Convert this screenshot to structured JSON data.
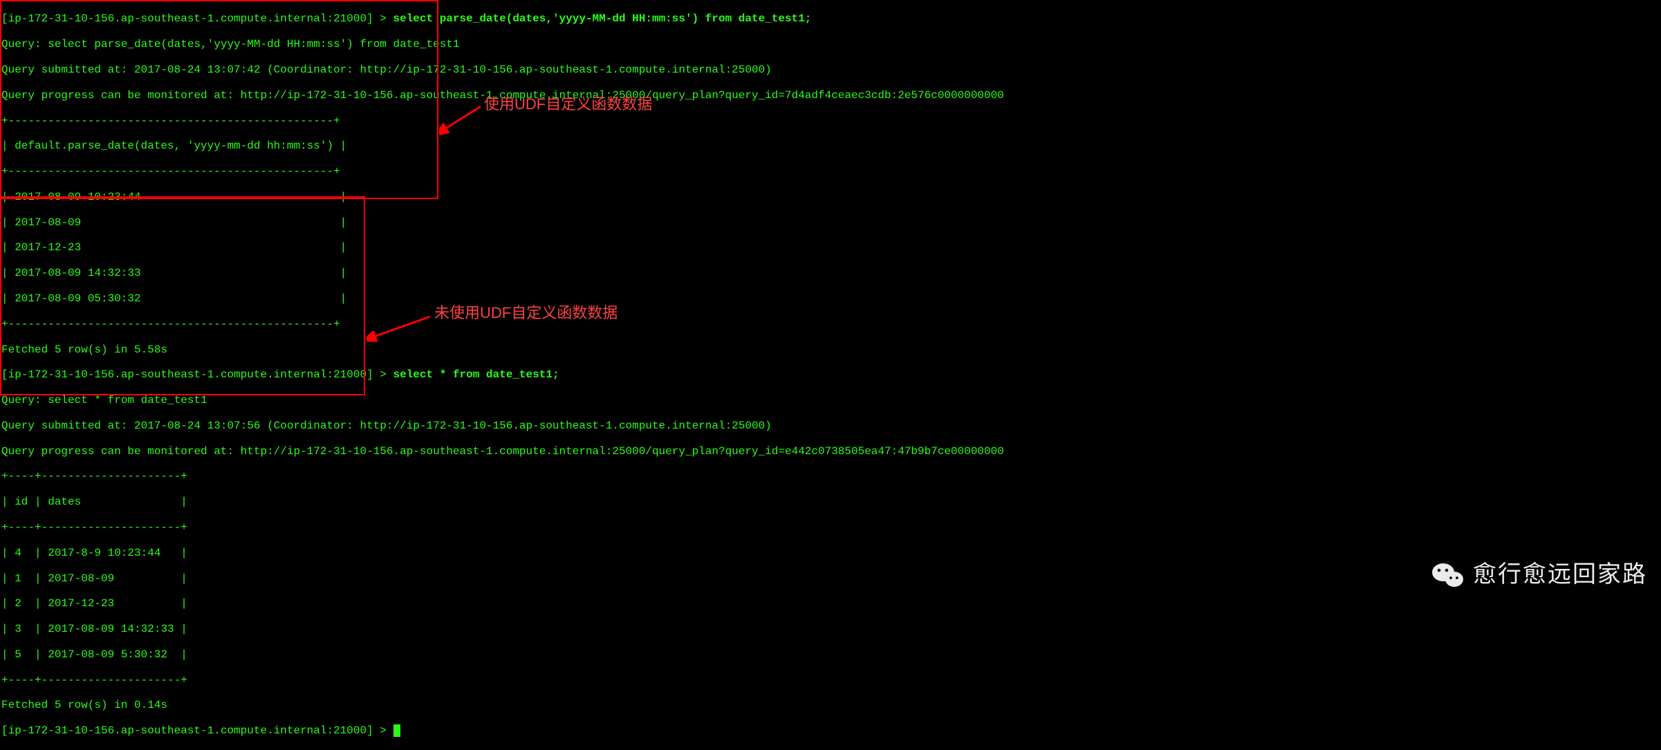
{
  "q1": {
    "prompt_host": "[ip-172-31-10-156.ap-southeast-1.compute.internal:21000] > ",
    "cmd": "select parse_date(dates,'yyyy-MM-dd HH:mm:ss') from date_test1;",
    "echo": "Query: select parse_date(dates,'yyyy-MM-dd HH:mm:ss') from date_test1",
    "submitted": "Query submitted at: 2017-08-24 13:07:42 (Coordinator: http://ip-172-31-10-156.ap-southeast-1.compute.internal:25000)",
    "progress": "Query progress can be monitored at: http://ip-172-31-10-156.ap-southeast-1.compute.internal:25000/query_plan?query_id=7d4adf4ceaec3cdb:2e576c0000000000",
    "tbl_border": "+-------------------------------------------------+",
    "tbl_header": "| default.parse_date(dates, 'yyyy-mm-dd hh:mm:ss') |",
    "rows": [
      "| 2017-08-09 10:23:44                              |",
      "| 2017-08-09                                       |",
      "| 2017-12-23                                       |",
      "| 2017-08-09 14:32:33                              |",
      "| 2017-08-09 05:30:32                              |"
    ],
    "fetched": "Fetched 5 row(s) in 5.58s"
  },
  "q2": {
    "prompt_host": "[ip-172-31-10-156.ap-southeast-1.compute.internal:21000] > ",
    "cmd": "select * from date_test1;",
    "echo": "Query: select * from date_test1",
    "submitted": "Query submitted at: 2017-08-24 13:07:56 (Coordinator: http://ip-172-31-10-156.ap-southeast-1.compute.internal:25000)",
    "progress": "Query progress can be monitored at: http://ip-172-31-10-156.ap-southeast-1.compute.internal:25000/query_plan?query_id=e442c0738505ea47:47b9b7ce00000000",
    "tbl_border": "+----+---------------------+",
    "tbl_header": "| id | dates               |",
    "rows": [
      "| 4  | 2017-8-9 10:23:44   |",
      "| 1  | 2017-08-09          |",
      "| 2  | 2017-12-23          |",
      "| 3  | 2017-08-09 14:32:33 |",
      "| 5  | 2017-08-09 5:30:32  |"
    ],
    "fetched": "Fetched 5 row(s) in 0.14s"
  },
  "final_prompt": "[ip-172-31-10-156.ap-southeast-1.compute.internal:21000] > ",
  "annotations": {
    "label1": "使用UDF自定义函数数据",
    "label2": "未使用UDF自定义函数数据"
  },
  "watermark": "愈行愈远回家路"
}
